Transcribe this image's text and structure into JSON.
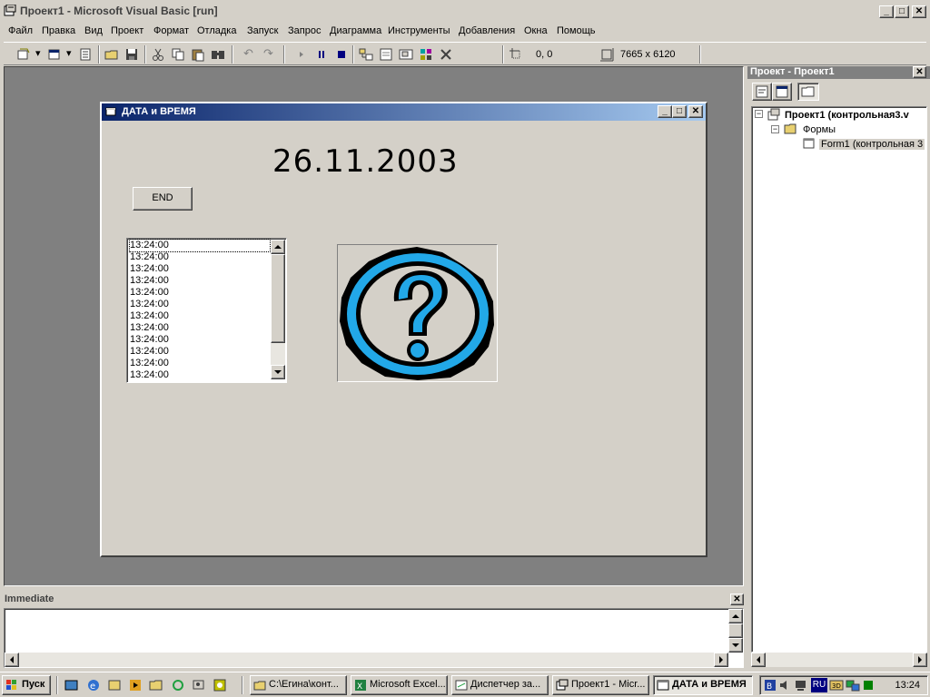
{
  "main_window": {
    "title": "Проект1 - Microsoft Visual Basic [run]",
    "icon": "vb-app-icon",
    "controls": {
      "minimize": "_",
      "maximize": "□",
      "close": "✕"
    }
  },
  "menu": [
    "Файл",
    "Правка",
    "Вид",
    "Проект",
    "Формат",
    "Отладка",
    "Запуск",
    "Запрос",
    "Диаграмма",
    "Инструменты",
    "Добавления",
    "Окна",
    "Помощь"
  ],
  "toolbar": {
    "position_readout": "0, 0",
    "size_readout": "7665 x 6120",
    "icons": [
      "add-project-icon",
      "add-form-icon",
      "menu-editor-icon",
      "open-icon",
      "save-icon",
      "cut-icon",
      "copy-icon",
      "paste-icon",
      "find-icon",
      "undo-icon",
      "redo-icon",
      "start-icon",
      "break-icon",
      "end-icon",
      "project-explorer-icon",
      "properties-icon",
      "form-layout-icon",
      "object-browser-icon",
      "toolbox-icon"
    ]
  },
  "form": {
    "title": "ДАТА и ВРЕМЯ",
    "date_text": "26.11.2003",
    "end_button_label": "END",
    "list_items": [
      "13:24:00",
      "13:24:00",
      "13:24:00",
      "13:24:00",
      "13:24:00",
      "13:24:00",
      "13:24:00",
      "13:24:00",
      "13:24:00",
      "13:24:00",
      "13:24:00",
      "13:24:00"
    ],
    "picture_icon": "question-mark-icon",
    "picture_colors": {
      "ring": "#22a8e8",
      "outline": "#000000"
    }
  },
  "project_panel": {
    "title": "Проект - Проект1",
    "root": "Проект1 (контрольная3.v",
    "folder": "Формы",
    "form_item": "Form1 (контрольная 3"
  },
  "immediate": {
    "title": "Immediate"
  },
  "taskbar": {
    "start_label": "Пуск",
    "buttons": [
      "C:\\Егина\\конт...",
      "Microsoft Excel...",
      "Диспетчер за...",
      "Проект1 - Micr...",
      "ДАТА и ВРЕМЯ"
    ],
    "clock": "13:24",
    "language": "RU"
  },
  "colors": {
    "desktop_gray": "#d4d0c8",
    "workspace": "#808080",
    "active_title_start": "#0a246a",
    "active_title_end": "#a6caf0"
  }
}
